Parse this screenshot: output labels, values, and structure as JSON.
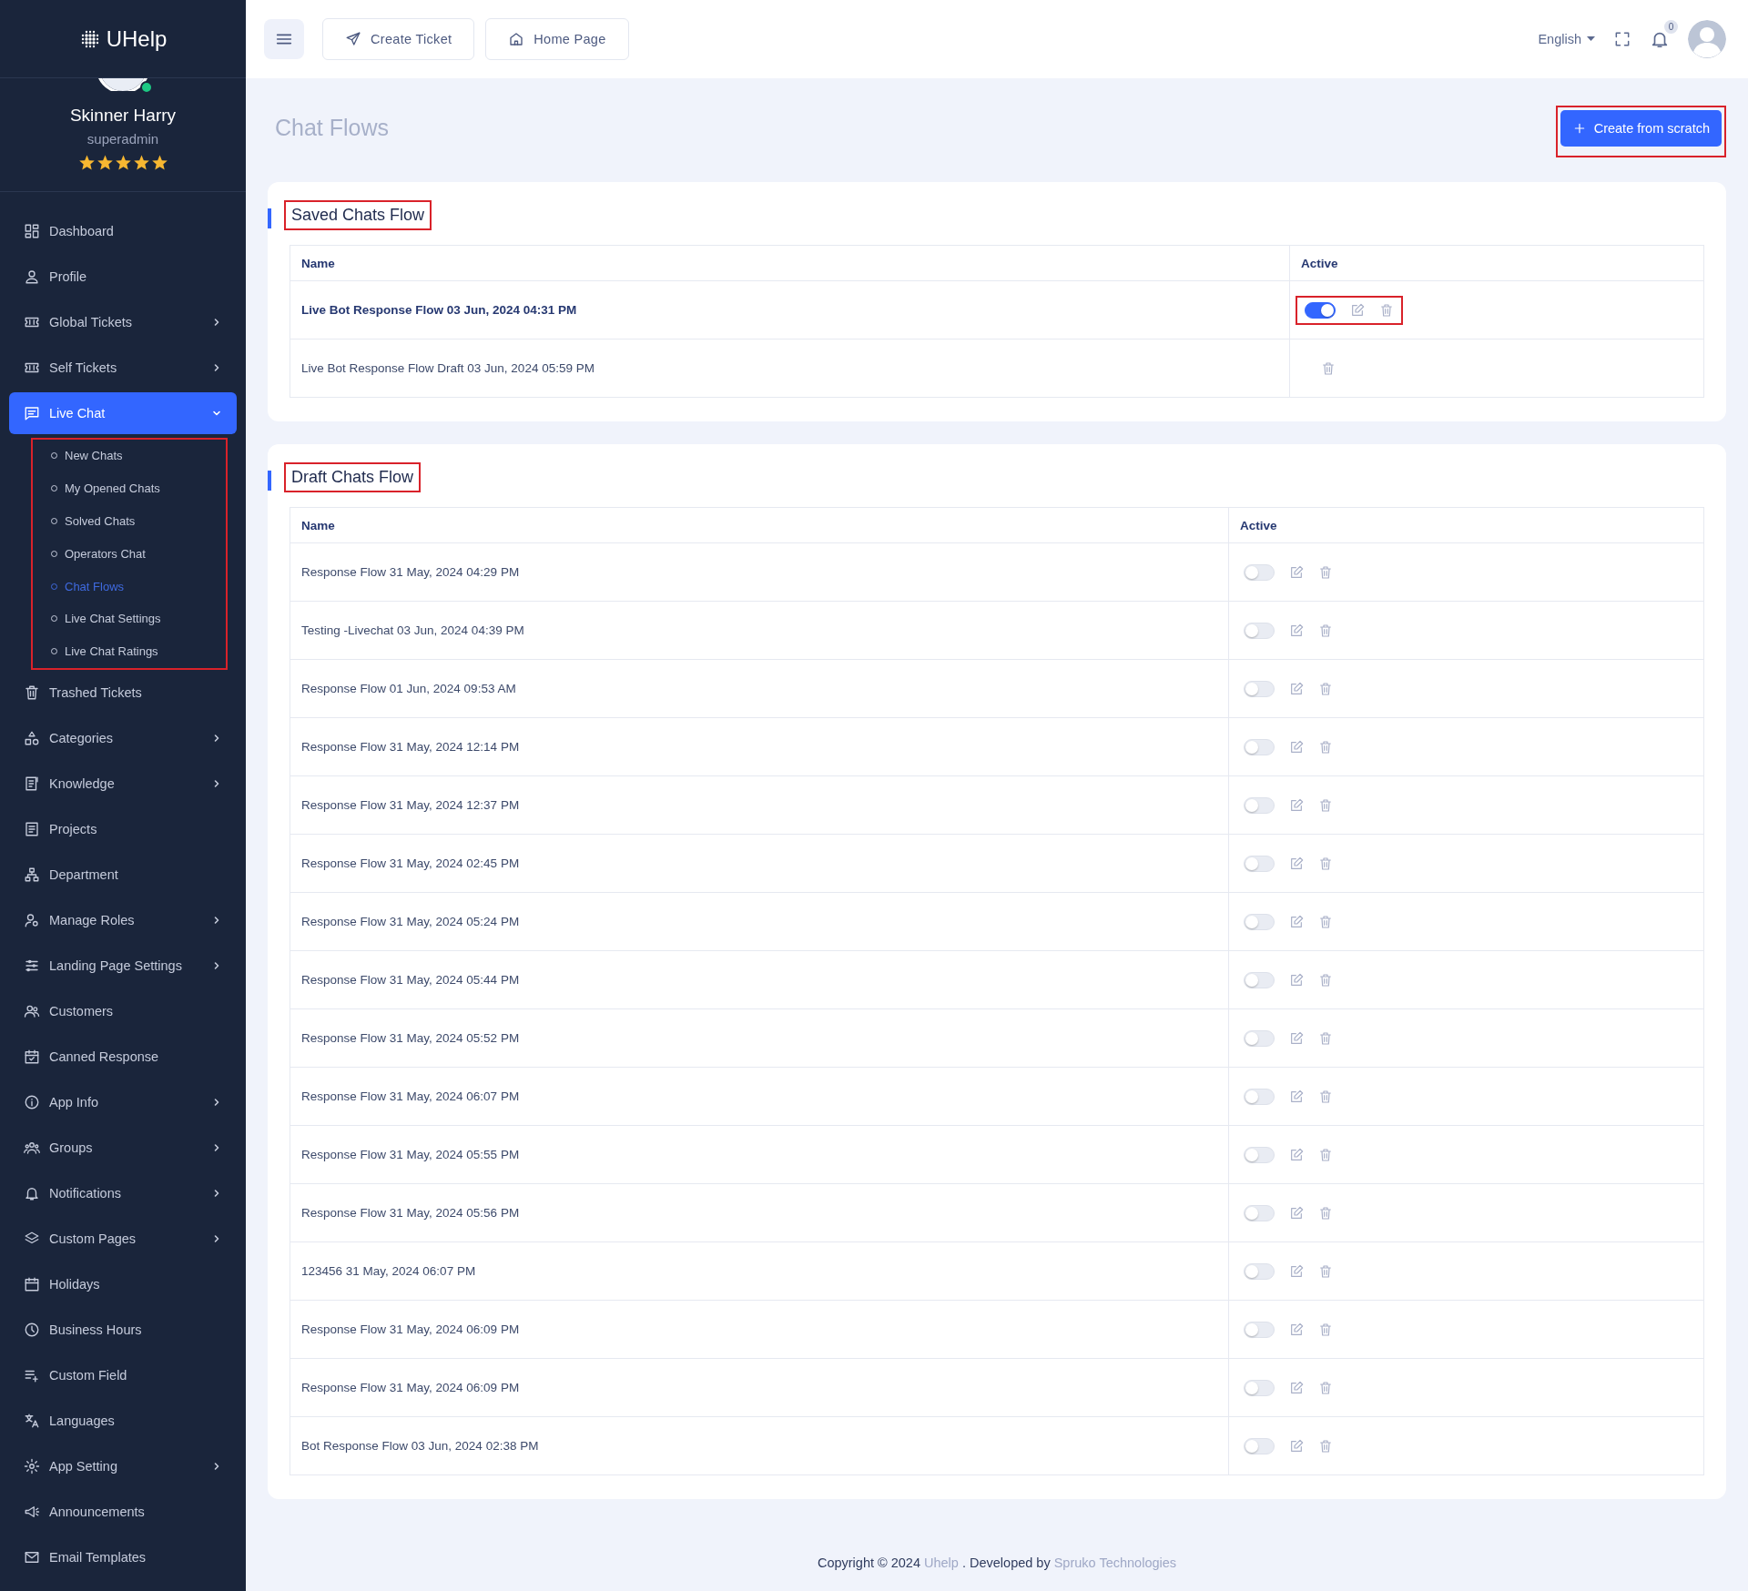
{
  "sidebar": {
    "logo": "UHelp",
    "user": {
      "name": "Skinner Harry",
      "role": "superadmin",
      "stars": 5,
      "online": true
    },
    "items": [
      {
        "label": "Dashboard",
        "expandable": false,
        "selected": false
      },
      {
        "label": "Profile",
        "expandable": false,
        "selected": false
      },
      {
        "label": "Global Tickets",
        "expandable": true,
        "expanded": false,
        "selected": false
      },
      {
        "label": "Self Tickets",
        "expandable": true,
        "expanded": false,
        "selected": false
      },
      {
        "label": "Live Chat",
        "expandable": true,
        "expanded": true,
        "selected": true,
        "highlighted": true,
        "children": [
          {
            "label": "New Chats",
            "selected": false
          },
          {
            "label": "My Opened Chats",
            "selected": false
          },
          {
            "label": "Solved Chats",
            "selected": false
          },
          {
            "label": "Operators Chat",
            "selected": false
          },
          {
            "label": "Chat Flows",
            "selected": true
          },
          {
            "label": "Live Chat Settings",
            "selected": false
          },
          {
            "label": "Live Chat Ratings",
            "selected": false
          }
        ]
      },
      {
        "label": "Trashed Tickets",
        "expandable": false,
        "selected": false
      },
      {
        "label": "Categories",
        "expandable": true,
        "expanded": false,
        "selected": false
      },
      {
        "label": "Knowledge",
        "expandable": true,
        "expanded": false,
        "selected": false
      },
      {
        "label": "Projects",
        "expandable": false,
        "selected": false
      },
      {
        "label": "Department",
        "expandable": false,
        "selected": false
      },
      {
        "label": "Manage Roles",
        "expandable": true,
        "expanded": false,
        "selected": false
      },
      {
        "label": "Landing Page Settings",
        "expandable": true,
        "expanded": false,
        "selected": false
      },
      {
        "label": "Customers",
        "expandable": false,
        "selected": false
      },
      {
        "label": "Canned Response",
        "expandable": false,
        "selected": false
      },
      {
        "label": "App Info",
        "expandable": true,
        "expanded": false,
        "selected": false
      },
      {
        "label": "Groups",
        "expandable": true,
        "expanded": false,
        "selected": false
      },
      {
        "label": "Notifications",
        "expandable": true,
        "expanded": false,
        "selected": false
      },
      {
        "label": "Custom Pages",
        "expandable": true,
        "expanded": false,
        "selected": false
      },
      {
        "label": "Holidays",
        "expandable": false,
        "selected": false
      },
      {
        "label": "Business Hours",
        "expandable": false,
        "selected": false
      },
      {
        "label": "Custom Field",
        "expandable": false,
        "selected": false
      },
      {
        "label": "Languages",
        "expandable": false,
        "selected": false
      },
      {
        "label": "App Setting",
        "expandable": true,
        "expanded": false,
        "selected": false
      },
      {
        "label": "Announcements",
        "expandable": false,
        "selected": false
      },
      {
        "label": "Email Templates",
        "expandable": false,
        "selected": false
      }
    ]
  },
  "header": {
    "buttons": [
      "Create Ticket",
      "Home Page"
    ],
    "language": "English",
    "notification_count": "0"
  },
  "page": {
    "title": "Chat Flows",
    "create_button": {
      "label": "Create from scratch",
      "highlighted": true
    }
  },
  "sections": [
    {
      "title": "Saved Chats Flow",
      "highlighted": true,
      "columns": [
        "Name",
        "Active"
      ],
      "rows": [
        {
          "name": "Live Bot Response Flow 03 Jun, 2024 04:31 PM",
          "active": true,
          "editable": true,
          "actions_highlighted": true
        },
        {
          "name": "Live Bot Response Flow Draft 03 Jun, 2024 05:59 PM",
          "editable": false,
          "actions_highlighted": false
        }
      ]
    },
    {
      "title": "Draft Chats Flow",
      "highlighted": true,
      "columns": [
        "Name",
        "Active"
      ],
      "rows": [
        {
          "name": "Response Flow 31 May, 2024 04:29 PM",
          "active": false,
          "editable": true,
          "actions_highlighted": false
        },
        {
          "name": "Testing -Livechat 03 Jun, 2024 04:39 PM",
          "active": false,
          "editable": true,
          "actions_highlighted": false
        },
        {
          "name": "Response Flow 01 Jun, 2024 09:53 AM",
          "active": false,
          "editable": true,
          "actions_highlighted": false
        },
        {
          "name": "Response Flow 31 May, 2024 12:14 PM",
          "active": false,
          "editable": true,
          "actions_highlighted": false
        },
        {
          "name": "Response Flow 31 May, 2024 12:37 PM",
          "active": false,
          "editable": true,
          "actions_highlighted": false
        },
        {
          "name": "Response Flow 31 May, 2024 02:45 PM",
          "active": false,
          "editable": true,
          "actions_highlighted": false
        },
        {
          "name": "Response Flow 31 May, 2024 05:24 PM",
          "active": false,
          "editable": true,
          "actions_highlighted": false
        },
        {
          "name": "Response Flow 31 May, 2024 05:44 PM",
          "active": false,
          "editable": true,
          "actions_highlighted": false
        },
        {
          "name": "Response Flow 31 May, 2024 05:52 PM",
          "active": false,
          "editable": true,
          "actions_highlighted": false
        },
        {
          "name": "Response Flow 31 May, 2024 06:07 PM",
          "active": false,
          "editable": true,
          "actions_highlighted": false
        },
        {
          "name": "Response Flow 31 May, 2024 05:55 PM",
          "active": false,
          "editable": true,
          "actions_highlighted": false
        },
        {
          "name": "Response Flow 31 May, 2024 05:56 PM",
          "active": false,
          "editable": true,
          "actions_highlighted": false
        },
        {
          "name": "123456 31 May, 2024 06:07 PM",
          "active": false,
          "editable": true,
          "actions_highlighted": false
        },
        {
          "name": "Response Flow 31 May, 2024 06:09 PM",
          "active": false,
          "editable": true,
          "actions_highlighted": false
        },
        {
          "name": "Response Flow 31 May, 2024 06:09 PM",
          "active": false,
          "editable": true,
          "actions_highlighted": false
        },
        {
          "name": "Bot Response Flow 03 Jun, 2024 02:38 PM",
          "active": false,
          "editable": true,
          "actions_highlighted": false
        }
      ]
    }
  ],
  "footer": {
    "parts": [
      {
        "kind": "text",
        "text": "Copyright © 2024 "
      },
      {
        "kind": "link",
        "text": "Uhelp"
      },
      {
        "kind": "text",
        "text": " . Developed by "
      },
      {
        "kind": "link",
        "text": "Spruko Technologies"
      }
    ]
  }
}
